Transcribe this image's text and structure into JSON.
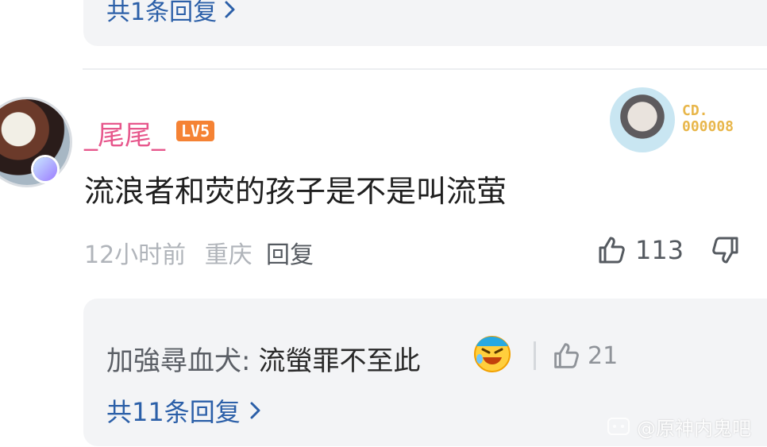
{
  "previous_thread": {
    "replies_link": "共1条回复"
  },
  "comment": {
    "username": "_尾尾_",
    "level_badge": "LV5",
    "fan_badge_text": [
      "CD.",
      "000008"
    ],
    "text": "流浪者和荧的孩子是不是叫流萤",
    "time": "12小时前",
    "location": "重庆",
    "reply_label": "回复",
    "likes": "113",
    "icons": {
      "like": "thumb-up-icon",
      "dislike": "thumb-down-icon"
    }
  },
  "reply_preview": {
    "author": "加強尋血犬:",
    "text": "流螢罪不至此",
    "emoji": "laughing-crying-emoji",
    "likes": "21",
    "more_link": "共11条回复"
  },
  "watermark": "@原神内鬼吧",
  "colors": {
    "username": "#e7578c",
    "link": "#2b5fa8",
    "level": "#f58234",
    "fan_badge": "#e8b64a"
  }
}
